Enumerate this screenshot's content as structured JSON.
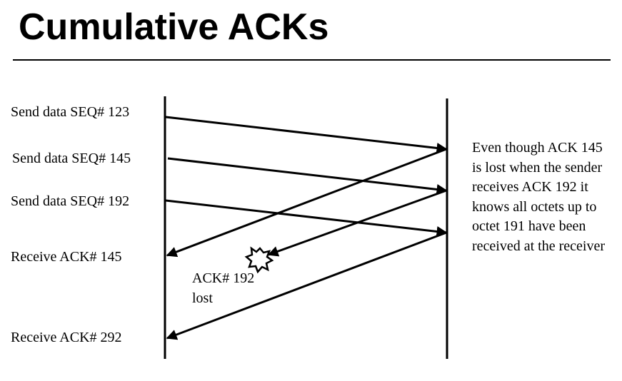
{
  "title": "Cumulative ACKs",
  "sender_labels": {
    "send_123": "Send data  SEQ# 123",
    "send_145": "Send data  SEQ# 145",
    "send_192": "Send data  SEQ# 192",
    "ack_145": "Receive ACK#  145",
    "ack_292": "Receive ACK#  292"
  },
  "lost_label": "ACK#  192 lost",
  "explanation": "Even though ACK 145 is lost when the sender receives ACK 192 it knows all octets up to octet 191 have been received at the receiver",
  "colors": {
    "ink": "#000000",
    "background": "#ffffff"
  },
  "icons": {
    "loss_marker": "explosion-star-icon"
  }
}
